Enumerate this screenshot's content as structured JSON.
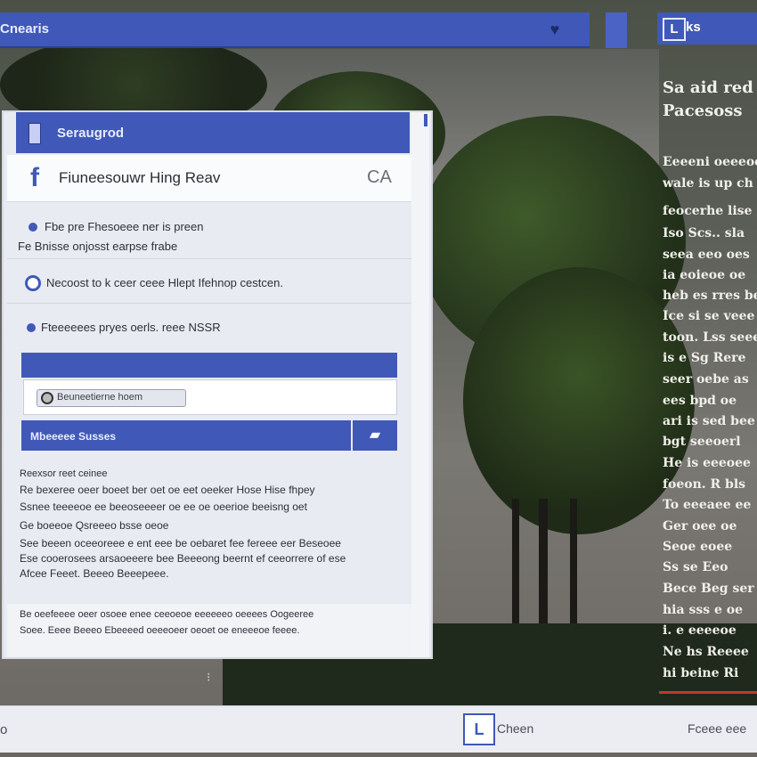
{
  "topbar": {
    "title": "Cnearis"
  },
  "right_tab": {
    "logo": "L",
    "label": "ks"
  },
  "panel": {
    "header": "Seraugrod",
    "profile_name": "Fiuneesouwr Hing Reav",
    "profile_badge": "CA",
    "lines": [
      "Fbe pre Fhesoeee ner is preen",
      "Fe Bnisse onjosst earpse frabe",
      "Necoost to k ceer ceee Hlept Ifehnop cestcen.",
      "Fteeeeees pryes oerls. reee NSSR"
    ],
    "input_text": "Beuneetierne hoem",
    "submit_label": "Mbeeeee Susses",
    "paragraphs": [
      "Reexsor reet ceinee",
      "Re bexeree oeer boeet ber oet oe eet oeeker Hose Hise fhpey",
      "Ssnee teeeeoe ee beeoseeeer oe ee oe oeerioe beeisng oet",
      "Ge boeeoe Qsreeeo bsse oeoe",
      "See beeen oceeoreee e ent eee be oebaret fee fereee eer Beseoee",
      "Ese cooerosees arsaoeeere bee Beeeong beernt ef ceeorrere of ese",
      "Afcee Feeet. Beeeo Beeepeee."
    ],
    "footer_lines": [
      "Be oeefeeee oeer osoee enee ceeoeoe eeeeeeo oeeees Oogeeree",
      "Soee. Eeee Beeeo Ebeeeed oeeeoeer oeoet oe eneeeoe feeee."
    ]
  },
  "right_column": {
    "heading_lines": [
      "Sa aid red a",
      "Pacesoss"
    ],
    "lines": [
      "Eeeeni oeeeoe",
      "wale is up ch",
      "feocerhe lise",
      "Iso Scs.. sla",
      "seea eeo oes",
      "ia eoieoe oe",
      "heb es rres be",
      "Ice si se veee",
      "toon. Lss seee",
      "is e Sg Rere",
      "seer oebe as",
      "ees bpd oe",
      "ari is sed bee",
      "bgt seeoerl",
      "He is eeeoee",
      "foeon. R bls",
      "To eeeaee ee",
      "Ger oee oe",
      "Seoe eoee",
      "Ss se Eeo",
      "Bece Beg ser",
      "hia sss e oe",
      "i. e eeeeoe",
      "Ne hs Reeee",
      "hi beine Ri"
    ]
  },
  "bottombar": {
    "left": "o",
    "logo": "L",
    "mid_label": "Cheen",
    "right_label": "Fceee eee"
  },
  "colors": {
    "accent": "#4058b7",
    "panel_bg": "#e9ebf2",
    "text_light": "#f0efe9"
  }
}
